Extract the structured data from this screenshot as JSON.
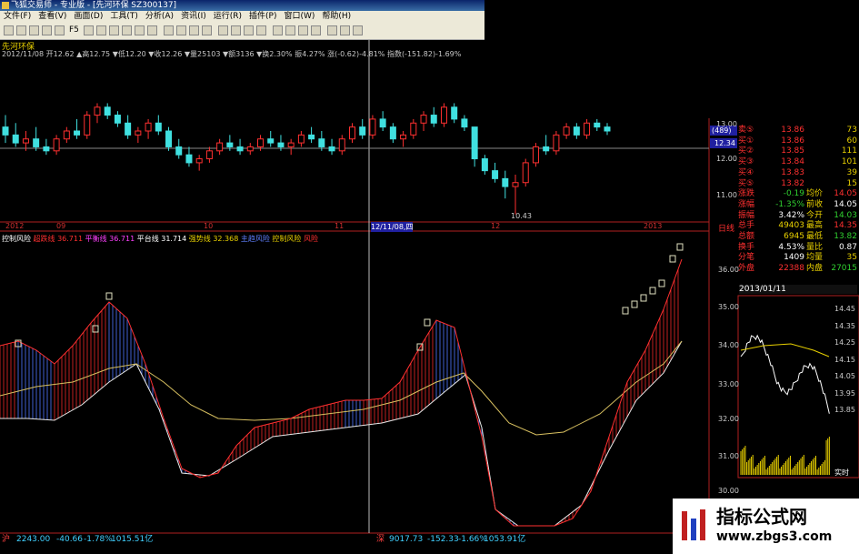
{
  "window": {
    "title": "飞狐交易师 - 专业版 - [先河环保 SZ300137]"
  },
  "menu": [
    "文件(F)",
    "查看(V)",
    "画面(D)",
    "工具(T)",
    "分析(A)",
    "资讯(I)",
    "运行(R)",
    "插件(P)",
    "窗口(W)",
    "帮助(H)"
  ],
  "toolbar": {
    "items_text": "F5"
  },
  "stock": {
    "name": "先河环保"
  },
  "info_line": "2012/11/08 开12.62 ▲高12.75 ▼低12.20 ▼收12.26 ▼量25103 ▼额3136 ▼换2.30% 振4.27% 涨(-0.62)-4.81% 指数(-151.82)-1.69%",
  "price_axis": [
    "13.00",
    "12.00",
    "11.00"
  ],
  "crosshair_price": "12.34",
  "scale_top": "(489)",
  "low_label": "10.43",
  "x_axis": [
    "2012",
    "09",
    "10",
    "11",
    "12/11/08,四",
    "12",
    "2013"
  ],
  "x_axis_right": "日线",
  "indicator": {
    "name": "控制风险",
    "items": [
      {
        "label": "超跌线",
        "value": "36.711",
        "color": "#ff3030"
      },
      {
        "label": "平衡线",
        "value": "36.711",
        "color": "#ff40ff"
      },
      {
        "label": "平台线",
        "value": "31.714",
        "color": "#ffffff"
      },
      {
        "label": "强势线",
        "value": "32.368",
        "color": "#e8d000"
      },
      {
        "label": "主趋风险",
        "value": "",
        "color": "#6080ff"
      },
      {
        "label": "控制风险",
        "value": "",
        "color": "#e8d000"
      },
      {
        "label": "风险",
        "value": "",
        "color": "#ff3030"
      }
    ]
  },
  "ind_axis": [
    "36.00",
    "35.00",
    "34.00",
    "33.00",
    "32.00",
    "31.00",
    "30.00"
  ],
  "quote": {
    "rows": [
      {
        "a": "卖⑤",
        "b": "13.86",
        "c": "",
        "d": "73",
        "ac": "#ff3030",
        "bc": "#ff3030",
        "dc": "#e8d000"
      },
      {
        "a": "买①",
        "b": "13.86",
        "c": "",
        "d": "60",
        "ac": "#ff3030",
        "bc": "#ff3030",
        "dc": "#e8d000"
      },
      {
        "a": "买②",
        "b": "13.85",
        "c": "",
        "d": "111",
        "ac": "#ff3030",
        "bc": "#ff3030",
        "dc": "#e8d000"
      },
      {
        "a": "买③",
        "b": "13.84",
        "c": "",
        "d": "101",
        "ac": "#ff3030",
        "bc": "#ff3030",
        "dc": "#e8d000"
      },
      {
        "a": "买④",
        "b": "13.83",
        "c": "",
        "d": "39",
        "ac": "#ff3030",
        "bc": "#ff3030",
        "dc": "#e8d000"
      },
      {
        "a": "买⑤",
        "b": "13.82",
        "c": "",
        "d": "15",
        "ac": "#ff3030",
        "bc": "#ff3030",
        "dc": "#e8d000"
      },
      {
        "a": "涨跌",
        "b": "-0.19",
        "c": "均价",
        "d": "14.05",
        "ac": "#ff3030",
        "bc": "#30d030",
        "dc": "#ff3030"
      },
      {
        "a": "涨幅",
        "b": "-1.35%",
        "c": "前收",
        "d": "14.05",
        "ac": "#ff3030",
        "bc": "#30d030",
        "dc": "#ffffff"
      },
      {
        "a": "振幅",
        "b": "3.42%",
        "c": "今开",
        "d": "14.03",
        "ac": "#ff3030",
        "bc": "#ffffff",
        "dc": "#30d030"
      },
      {
        "a": "总手",
        "b": "49403",
        "c": "最高",
        "d": "14.35",
        "ac": "#ff3030",
        "bc": "#e8d000",
        "dc": "#ff3030"
      },
      {
        "a": "总额",
        "b": "6945",
        "c": "最低",
        "d": "13.82",
        "ac": "#ff3030",
        "bc": "#e8d000",
        "dc": "#30d030"
      },
      {
        "a": "换手",
        "b": "4.53%",
        "c": "量比",
        "d": "0.87",
        "ac": "#ff3030",
        "bc": "#ffffff",
        "dc": "#ffffff"
      },
      {
        "a": "分笔",
        "b": "1409",
        "c": "均量",
        "d": "35",
        "ac": "#ff3030",
        "bc": "#ffffff",
        "dc": "#e8d000"
      },
      {
        "a": "外盘",
        "b": "22388",
        "c": "内盘",
        "d": "27015",
        "ac": "#ff3030",
        "bc": "#ff3030",
        "dc": "#30d030"
      }
    ],
    "date": "2013/01/11",
    "intraday_axis": [
      "14.45",
      "14.35",
      "14.25",
      "14.15",
      "14.05",
      "13.95",
      "13.85"
    ],
    "realtime": "实时"
  },
  "status": {
    "sh": {
      "label": "沪",
      "index": "2243.00",
      "chg": "-40.66",
      "pct": "-1.78%",
      "amount": "1015.51亿"
    },
    "sz": {
      "label": "深",
      "index": "9017.73",
      "chg": "-152.33",
      "pct": "-1.66%",
      "amount": "1053.91亿"
    }
  },
  "watermark": {
    "title": "指标公式网",
    "url": "www.zbgs3.com"
  },
  "chart_data": {
    "type": "candlestick",
    "ylim": [
      10.3,
      13.6
    ],
    "candles": [
      [
        12.6,
        12.9,
        12.2,
        12.4
      ],
      [
        12.4,
        12.7,
        12.1,
        12.2
      ],
      [
        12.2,
        12.5,
        12.0,
        12.3
      ],
      [
        12.3,
        12.6,
        12.0,
        12.1
      ],
      [
        12.1,
        12.3,
        11.9,
        12.0
      ],
      [
        12.0,
        12.4,
        11.9,
        12.3
      ],
      [
        12.3,
        12.6,
        12.2,
        12.5
      ],
      [
        12.5,
        12.8,
        12.3,
        12.4
      ],
      [
        12.4,
        13.0,
        12.3,
        12.9
      ],
      [
        12.9,
        13.2,
        12.7,
        13.1
      ],
      [
        13.1,
        13.2,
        12.8,
        12.9
      ],
      [
        12.9,
        13.0,
        12.6,
        12.7
      ],
      [
        12.7,
        12.9,
        12.3,
        12.4
      ],
      [
        12.4,
        12.6,
        12.2,
        12.5
      ],
      [
        12.5,
        12.8,
        12.3,
        12.7
      ],
      [
        12.7,
        12.9,
        12.4,
        12.5
      ],
      [
        12.5,
        12.6,
        12.0,
        12.1
      ],
      [
        12.1,
        12.3,
        11.8,
        11.9
      ],
      [
        11.9,
        12.1,
        11.6,
        11.7
      ],
      [
        11.7,
        11.9,
        11.5,
        11.8
      ],
      [
        11.8,
        12.1,
        11.7,
        12.0
      ],
      [
        12.0,
        12.3,
        11.9,
        12.2
      ],
      [
        12.2,
        12.4,
        12.0,
        12.1
      ],
      [
        12.1,
        12.3,
        11.9,
        12.0
      ],
      [
        12.0,
        12.2,
        11.9,
        12.1
      ],
      [
        12.1,
        12.4,
        12.0,
        12.3
      ],
      [
        12.3,
        12.5,
        12.1,
        12.2
      ],
      [
        12.2,
        12.4,
        12.0,
        12.1
      ],
      [
        12.1,
        12.3,
        11.9,
        12.2
      ],
      [
        12.2,
        12.5,
        12.1,
        12.4
      ],
      [
        12.4,
        12.6,
        12.2,
        12.3
      ],
      [
        12.3,
        12.5,
        12.0,
        12.1
      ],
      [
        12.1,
        12.3,
        11.9,
        12.0
      ],
      [
        12.0,
        12.4,
        11.9,
        12.3
      ],
      [
        12.3,
        12.7,
        12.2,
        12.6
      ],
      [
        12.6,
        12.8,
        12.3,
        12.4
      ],
      [
        12.4,
        12.9,
        12.3,
        12.8
      ],
      [
        12.8,
        13.0,
        12.5,
        12.6
      ],
      [
        12.6,
        12.7,
        12.2,
        12.3
      ],
      [
        12.3,
        12.5,
        12.1,
        12.4
      ],
      [
        12.4,
        12.8,
        12.3,
        12.7
      ],
      [
        12.7,
        13.0,
        12.5,
        12.9
      ],
      [
        12.9,
        13.1,
        12.6,
        12.7
      ],
      [
        12.7,
        13.2,
        12.6,
        13.1
      ],
      [
        13.1,
        13.2,
        12.7,
        12.8
      ],
      [
        12.8,
        12.9,
        12.5,
        12.6
      ],
      [
        12.6,
        12.6,
        11.6,
        11.8
      ],
      [
        11.8,
        11.9,
        11.4,
        11.5
      ],
      [
        11.5,
        11.7,
        11.2,
        11.3
      ],
      [
        11.3,
        11.5,
        10.8,
        11.1
      ],
      [
        11.1,
        11.4,
        10.4,
        11.2
      ],
      [
        11.2,
        11.8,
        11.1,
        11.7
      ],
      [
        11.7,
        12.2,
        11.6,
        12.1
      ],
      [
        12.1,
        12.4,
        11.9,
        12.0
      ],
      [
        12.0,
        12.5,
        11.9,
        12.4
      ],
      [
        12.4,
        12.7,
        12.3,
        12.6
      ],
      [
        12.6,
        12.7,
        12.3,
        12.4
      ],
      [
        12.4,
        12.8,
        12.3,
        12.7
      ],
      [
        12.7,
        12.8,
        12.5,
        12.6
      ],
      [
        12.6,
        12.7,
        12.4,
        12.5
      ]
    ]
  }
}
